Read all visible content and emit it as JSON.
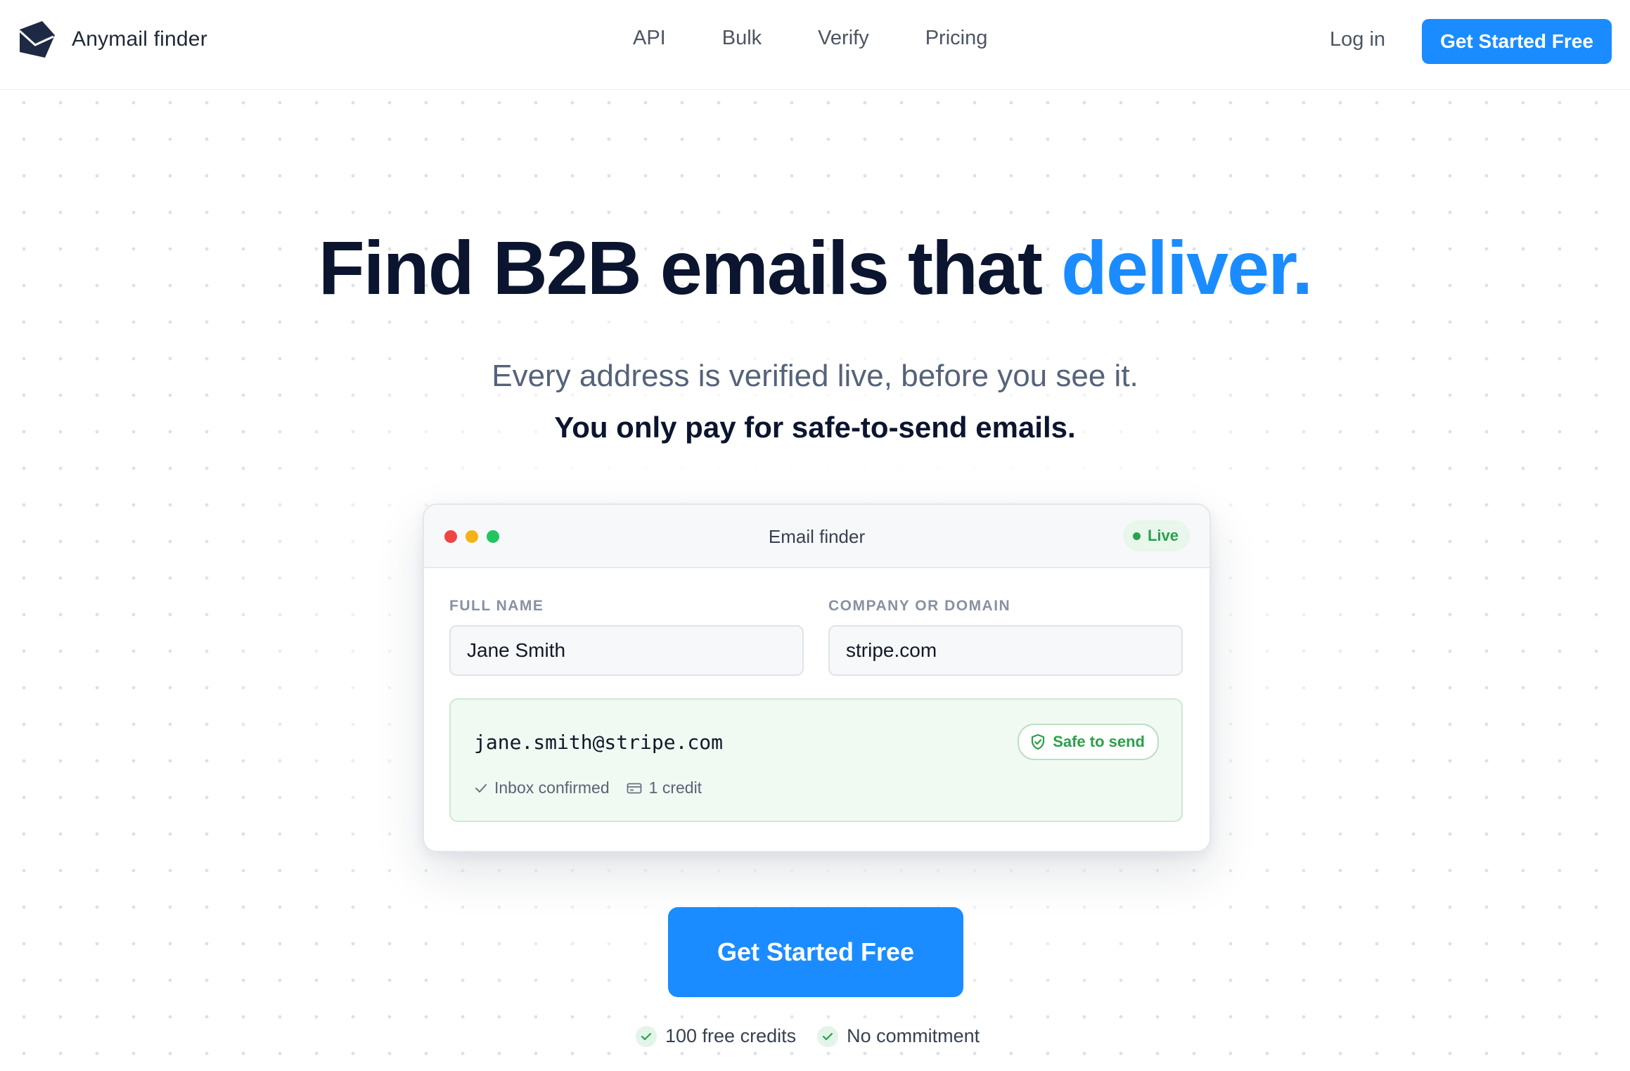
{
  "brand": {
    "name": "Anymail finder",
    "icon": "envelope-logo-icon"
  },
  "nav": {
    "items": [
      "API",
      "Bulk",
      "Verify",
      "Pricing"
    ]
  },
  "header": {
    "login": "Log in",
    "cta": "Get Started Free"
  },
  "hero": {
    "title_main": "Find B2B emails that ",
    "title_accent": "deliver.",
    "subtitle": "Every address is verified live, before you see it.",
    "tagline": "You only pay for safe-to-send emails."
  },
  "card": {
    "title": "Email finder",
    "status": "Live",
    "fields": {
      "name_label": "FULL NAME",
      "name_value": "Jane Smith",
      "domain_label": "COMPANY OR DOMAIN",
      "domain_value": "stripe.com"
    },
    "result": {
      "email": "jane.smith@stripe.com",
      "badge": "Safe to send",
      "inbox": "Inbox confirmed",
      "credit": "1 credit"
    }
  },
  "cta": {
    "label": "Get Started Free",
    "perks": [
      "100 free credits",
      "No commitment"
    ]
  },
  "colors": {
    "accent": "#1a8cff",
    "dark": "#0b1530",
    "success": "#2aa14a",
    "success_bg": "#f1f9f3"
  }
}
